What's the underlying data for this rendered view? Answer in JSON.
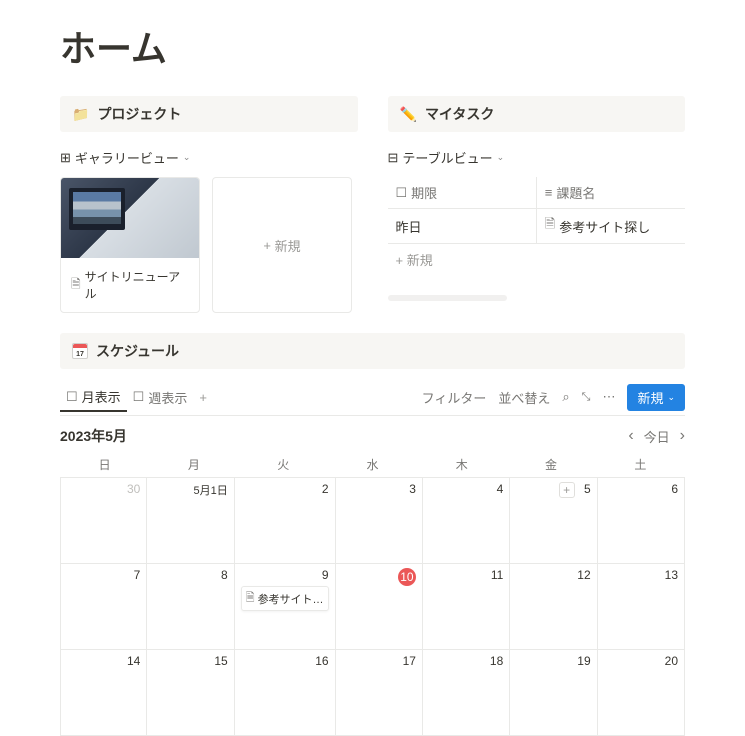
{
  "page_title": "ホーム",
  "projects": {
    "title": "プロジェクト",
    "view_label": "ギャラリービュー",
    "card_title": "サイトリニューアル",
    "new_label": "新規"
  },
  "tasks": {
    "title": "マイタスク",
    "view_label": "テーブルビュー",
    "col_deadline": "期限",
    "col_taskname": "課題名",
    "row1_deadline": "昨日",
    "row1_taskname": "参考サイト探し",
    "new_label": "新規"
  },
  "schedule": {
    "title": "スケジュール",
    "tab_month": "月表示",
    "tab_week": "週表示",
    "filter": "フィルター",
    "sort": "並べ替え",
    "new": "新規",
    "month_label": "2023年5月",
    "today": "今日",
    "weekdays": [
      "日",
      "月",
      "火",
      "水",
      "木",
      "金",
      "土"
    ],
    "event_label": "参考サイト…",
    "today_date": "10",
    "dates": [
      {
        "d": "30",
        "muted": true
      },
      {
        "d": "5月1日"
      },
      {
        "d": "2"
      },
      {
        "d": "3"
      },
      {
        "d": "4"
      },
      {
        "d": "5",
        "add": true
      },
      {
        "d": "6"
      },
      {
        "d": "7"
      },
      {
        "d": "8"
      },
      {
        "d": "9",
        "event": true
      },
      {
        "d": "10",
        "today": true
      },
      {
        "d": "11"
      },
      {
        "d": "12"
      },
      {
        "d": "13"
      },
      {
        "d": "14"
      },
      {
        "d": "15"
      },
      {
        "d": "16"
      },
      {
        "d": "17"
      },
      {
        "d": "18"
      },
      {
        "d": "19"
      },
      {
        "d": "20"
      }
    ]
  }
}
